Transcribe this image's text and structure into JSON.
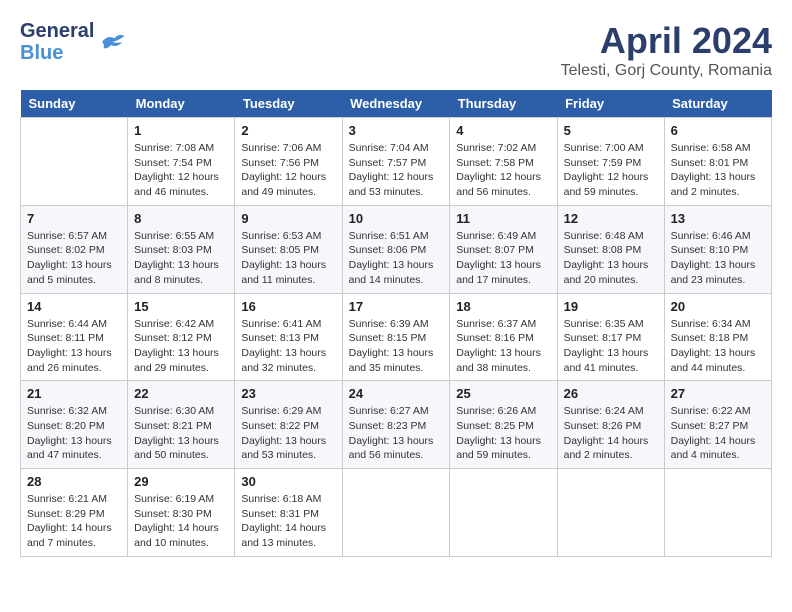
{
  "header": {
    "logo_line1": "General",
    "logo_line2": "Blue",
    "month": "April 2024",
    "location": "Telesti, Gorj County, Romania"
  },
  "weekdays": [
    "Sunday",
    "Monday",
    "Tuesday",
    "Wednesday",
    "Thursday",
    "Friday",
    "Saturday"
  ],
  "weeks": [
    [
      {
        "day": "",
        "content": ""
      },
      {
        "day": "1",
        "content": "Sunrise: 7:08 AM\nSunset: 7:54 PM\nDaylight: 12 hours\nand 46 minutes."
      },
      {
        "day": "2",
        "content": "Sunrise: 7:06 AM\nSunset: 7:56 PM\nDaylight: 12 hours\nand 49 minutes."
      },
      {
        "day": "3",
        "content": "Sunrise: 7:04 AM\nSunset: 7:57 PM\nDaylight: 12 hours\nand 53 minutes."
      },
      {
        "day": "4",
        "content": "Sunrise: 7:02 AM\nSunset: 7:58 PM\nDaylight: 12 hours\nand 56 minutes."
      },
      {
        "day": "5",
        "content": "Sunrise: 7:00 AM\nSunset: 7:59 PM\nDaylight: 12 hours\nand 59 minutes."
      },
      {
        "day": "6",
        "content": "Sunrise: 6:58 AM\nSunset: 8:01 PM\nDaylight: 13 hours\nand 2 minutes."
      }
    ],
    [
      {
        "day": "7",
        "content": "Sunrise: 6:57 AM\nSunset: 8:02 PM\nDaylight: 13 hours\nand 5 minutes."
      },
      {
        "day": "8",
        "content": "Sunrise: 6:55 AM\nSunset: 8:03 PM\nDaylight: 13 hours\nand 8 minutes."
      },
      {
        "day": "9",
        "content": "Sunrise: 6:53 AM\nSunset: 8:05 PM\nDaylight: 13 hours\nand 11 minutes."
      },
      {
        "day": "10",
        "content": "Sunrise: 6:51 AM\nSunset: 8:06 PM\nDaylight: 13 hours\nand 14 minutes."
      },
      {
        "day": "11",
        "content": "Sunrise: 6:49 AM\nSunset: 8:07 PM\nDaylight: 13 hours\nand 17 minutes."
      },
      {
        "day": "12",
        "content": "Sunrise: 6:48 AM\nSunset: 8:08 PM\nDaylight: 13 hours\nand 20 minutes."
      },
      {
        "day": "13",
        "content": "Sunrise: 6:46 AM\nSunset: 8:10 PM\nDaylight: 13 hours\nand 23 minutes."
      }
    ],
    [
      {
        "day": "14",
        "content": "Sunrise: 6:44 AM\nSunset: 8:11 PM\nDaylight: 13 hours\nand 26 minutes."
      },
      {
        "day": "15",
        "content": "Sunrise: 6:42 AM\nSunset: 8:12 PM\nDaylight: 13 hours\nand 29 minutes."
      },
      {
        "day": "16",
        "content": "Sunrise: 6:41 AM\nSunset: 8:13 PM\nDaylight: 13 hours\nand 32 minutes."
      },
      {
        "day": "17",
        "content": "Sunrise: 6:39 AM\nSunset: 8:15 PM\nDaylight: 13 hours\nand 35 minutes."
      },
      {
        "day": "18",
        "content": "Sunrise: 6:37 AM\nSunset: 8:16 PM\nDaylight: 13 hours\nand 38 minutes."
      },
      {
        "day": "19",
        "content": "Sunrise: 6:35 AM\nSunset: 8:17 PM\nDaylight: 13 hours\nand 41 minutes."
      },
      {
        "day": "20",
        "content": "Sunrise: 6:34 AM\nSunset: 8:18 PM\nDaylight: 13 hours\nand 44 minutes."
      }
    ],
    [
      {
        "day": "21",
        "content": "Sunrise: 6:32 AM\nSunset: 8:20 PM\nDaylight: 13 hours\nand 47 minutes."
      },
      {
        "day": "22",
        "content": "Sunrise: 6:30 AM\nSunset: 8:21 PM\nDaylight: 13 hours\nand 50 minutes."
      },
      {
        "day": "23",
        "content": "Sunrise: 6:29 AM\nSunset: 8:22 PM\nDaylight: 13 hours\nand 53 minutes."
      },
      {
        "day": "24",
        "content": "Sunrise: 6:27 AM\nSunset: 8:23 PM\nDaylight: 13 hours\nand 56 minutes."
      },
      {
        "day": "25",
        "content": "Sunrise: 6:26 AM\nSunset: 8:25 PM\nDaylight: 13 hours\nand 59 minutes."
      },
      {
        "day": "26",
        "content": "Sunrise: 6:24 AM\nSunset: 8:26 PM\nDaylight: 14 hours\nand 2 minutes."
      },
      {
        "day": "27",
        "content": "Sunrise: 6:22 AM\nSunset: 8:27 PM\nDaylight: 14 hours\nand 4 minutes."
      }
    ],
    [
      {
        "day": "28",
        "content": "Sunrise: 6:21 AM\nSunset: 8:29 PM\nDaylight: 14 hours\nand 7 minutes."
      },
      {
        "day": "29",
        "content": "Sunrise: 6:19 AM\nSunset: 8:30 PM\nDaylight: 14 hours\nand 10 minutes."
      },
      {
        "day": "30",
        "content": "Sunrise: 6:18 AM\nSunset: 8:31 PM\nDaylight: 14 hours\nand 13 minutes."
      },
      {
        "day": "",
        "content": ""
      },
      {
        "day": "",
        "content": ""
      },
      {
        "day": "",
        "content": ""
      },
      {
        "day": "",
        "content": ""
      }
    ]
  ]
}
